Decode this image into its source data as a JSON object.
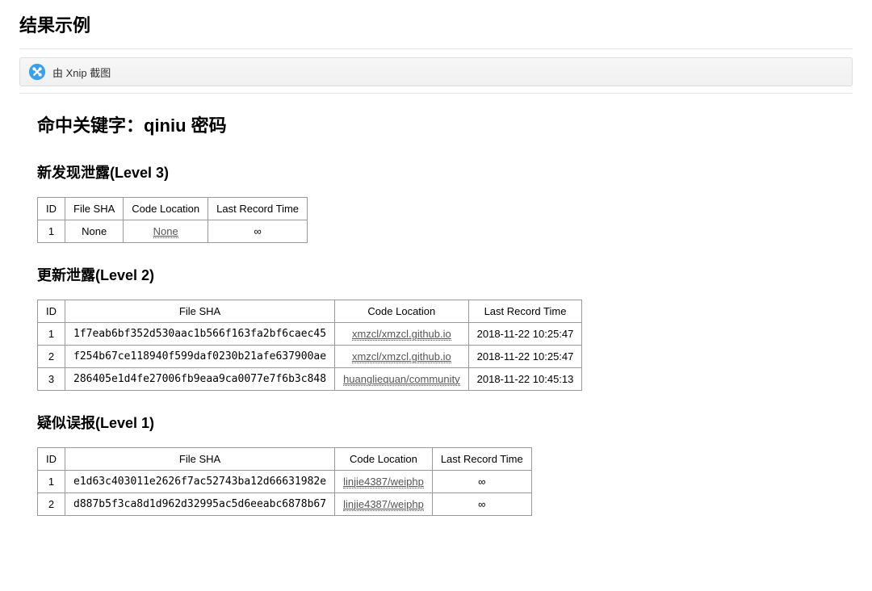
{
  "page_title": "结果示例",
  "xnip_banner": "由 Xnip 截图",
  "report": {
    "keyword_title": "命中关键字：qiniu 密码",
    "level3_title": "新发现泄露(Level 3)",
    "level2_title": "更新泄露(Level 2)",
    "level1_title": "疑似误报(Level 1)",
    "columns": {
      "id": "ID",
      "sha": "File SHA",
      "loc": "Code Location",
      "time": "Last Record Time"
    },
    "level3_rows": [
      {
        "id": "1",
        "sha": "None",
        "loc": "None",
        "time": "∞"
      }
    ],
    "level2_rows": [
      {
        "id": "1",
        "sha": "1f7eab6bf352d530aac1b566f163fa2bf6caec45",
        "loc": "xmzcl/xmzcl.github.io",
        "time": "2018-11-22 10:25:47"
      },
      {
        "id": "2",
        "sha": "f254b67ce118940f599daf0230b21afe637900ae",
        "loc": "xmzcl/xmzcl.github.io",
        "time": "2018-11-22 10:25:47"
      },
      {
        "id": "3",
        "sha": "286405e1d4fe27006fb9eaa9ca0077e7f6b3c848",
        "loc": "huangliequan/community",
        "time": "2018-11-22 10:45:13"
      }
    ],
    "level1_rows": [
      {
        "id": "1",
        "sha": "e1d63c403011e2626f7ac52743ba12d66631982e",
        "loc": "linjie4387/weiphp",
        "time": "∞"
      },
      {
        "id": "2",
        "sha": "d887b5f3ca8d1d962d32995ac5d6eeabc6878b67",
        "loc": "linjie4387/weiphp",
        "time": "∞"
      }
    ]
  }
}
